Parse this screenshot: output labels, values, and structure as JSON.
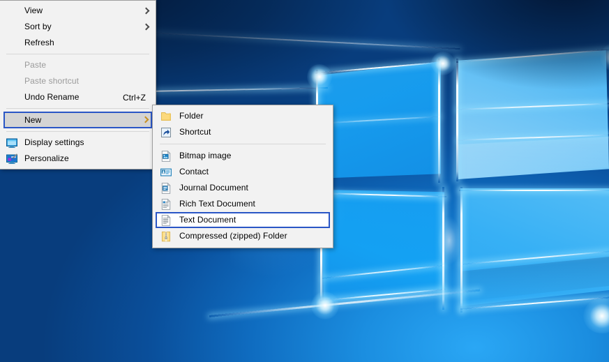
{
  "desktop": {
    "wallpaper_name": "windows-10-hero-wallpaper",
    "colors": {
      "accent_blue": "#0078d7",
      "wallpaper_deep": "#05264f",
      "wallpaper_mid": "#0e5ba3",
      "wallpaper_light": "#9ad9fc",
      "menu_background": "#f2f2f2",
      "menu_border": "#9e9e9e",
      "focus_border": "#2a56c6",
      "selected_fill": "#d4d4d4",
      "disabled_text": "#9b9b9b",
      "separator": "#d7d7d7",
      "folder_yellow": "#fcd97c",
      "submenu_chevron": "#c8901f"
    }
  },
  "context_menu": {
    "name": "desktop-context-menu",
    "items": [
      {
        "label": "View",
        "type": "submenu",
        "icon": null,
        "accel": "",
        "disabled": false,
        "selected": false,
        "chevron": true
      },
      {
        "label": "Sort by",
        "type": "submenu",
        "icon": null,
        "accel": "",
        "disabled": false,
        "selected": false,
        "chevron": true
      },
      {
        "label": "Refresh",
        "type": "command",
        "icon": null,
        "accel": "",
        "disabled": false,
        "selected": false,
        "chevron": false
      },
      {
        "label": "__SEP__",
        "type": "separator"
      },
      {
        "label": "Paste",
        "type": "command",
        "icon": null,
        "accel": "",
        "disabled": true,
        "selected": false,
        "chevron": false
      },
      {
        "label": "Paste shortcut",
        "type": "command",
        "icon": null,
        "accel": "",
        "disabled": true,
        "selected": false,
        "chevron": false
      },
      {
        "label": "Undo Rename",
        "type": "command",
        "icon": null,
        "accel": "Ctrl+Z",
        "disabled": false,
        "selected": false,
        "chevron": false
      },
      {
        "label": "__SEP__",
        "type": "separator"
      },
      {
        "label": "New",
        "type": "submenu",
        "icon": null,
        "accel": "",
        "disabled": false,
        "selected": true,
        "chevron": true
      },
      {
        "label": "__SEP__",
        "type": "separator"
      },
      {
        "label": "Display settings",
        "type": "command",
        "icon": "monitor-icon",
        "accel": "",
        "disabled": false,
        "selected": false,
        "chevron": false
      },
      {
        "label": "Personalize",
        "type": "command",
        "icon": "personalize-icon",
        "accel": "",
        "disabled": false,
        "selected": false,
        "chevron": false
      }
    ]
  },
  "submenu": {
    "name": "new-submenu",
    "parent_item": "New",
    "items": [
      {
        "label": "Folder",
        "icon": "folder-icon",
        "selected": false
      },
      {
        "label": "Shortcut",
        "icon": "shortcut-icon",
        "selected": false
      },
      {
        "label": "__SEP__",
        "type": "separator"
      },
      {
        "label": "Bitmap image",
        "icon": "bitmap-image-icon",
        "selected": false
      },
      {
        "label": "Contact",
        "icon": "contact-icon",
        "selected": false
      },
      {
        "label": "Journal Document",
        "icon": "journal-icon",
        "selected": false
      },
      {
        "label": "Rich Text Document",
        "icon": "rich-text-icon",
        "selected": false
      },
      {
        "label": "Text Document",
        "icon": "text-document-icon",
        "selected": true
      },
      {
        "label": "Compressed (zipped) Folder",
        "icon": "zip-folder-icon",
        "selected": false
      }
    ]
  }
}
